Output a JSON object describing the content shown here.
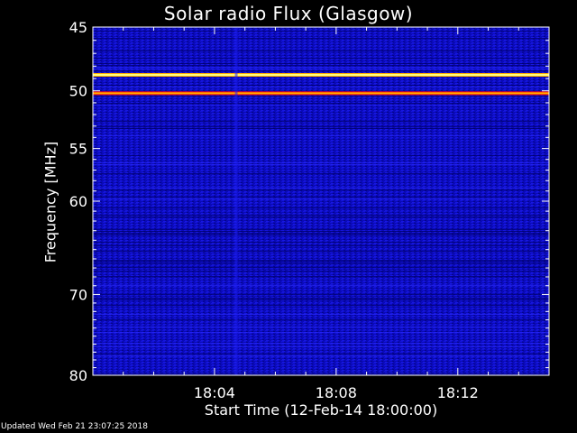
{
  "chart_data": {
    "type": "heatmap",
    "title": "Solar radio Flux (Glasgow)",
    "xlabel": "Start Time (12-Feb-14 18:00:00)",
    "ylabel": "Frequency [MHz]",
    "x_ticks": [
      "18:04",
      "18:08",
      "18:12"
    ],
    "x_tick_minutes": [
      4,
      8,
      12
    ],
    "xlim_minutes": [
      0,
      15
    ],
    "y_ticks": [
      45,
      50,
      55,
      60,
      70,
      80
    ],
    "ylim": [
      45,
      80
    ],
    "y_scale": "log",
    "colormap": [
      "#000033",
      "#0000c0",
      "#2020ff",
      "#ff0000",
      "#ffb000",
      "#ffff80"
    ],
    "features": [
      {
        "name": "persistent emission",
        "freq_mhz": 48.7,
        "level": 1.0
      },
      {
        "name": "persistent emission",
        "freq_mhz": 50.2,
        "level": 0.8
      },
      {
        "name": "spike column",
        "time_minutes": 4.7,
        "level": 0.4
      }
    ]
  },
  "footer": {
    "text": "Updated Wed Feb 21 23:07:25 2018"
  }
}
